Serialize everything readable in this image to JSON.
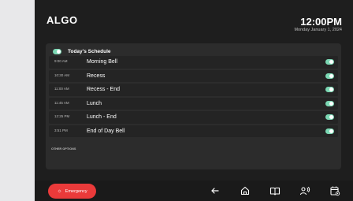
{
  "brand": "ALGO",
  "clock": {
    "time": "12:00PM",
    "date": "Monday January 1, 2024"
  },
  "schedule": {
    "title": "Today's Schedule",
    "enabled": true,
    "rows": [
      {
        "time": "9:00 AM",
        "name": "Morning Bell",
        "enabled": true
      },
      {
        "time": "10:30 AM",
        "name": "Recess",
        "enabled": true
      },
      {
        "time": "11:00 AM",
        "name": "Recess - End",
        "enabled": true
      },
      {
        "time": "11:45 AM",
        "name": "Lunch",
        "enabled": true
      },
      {
        "time": "12:25 PM",
        "name": "Lunch - End",
        "enabled": true
      },
      {
        "time": "3:51 PM",
        "name": "End of Day Bell",
        "enabled": true
      }
    ],
    "other_options": "OTHER OPTIONS"
  },
  "bottom_bar": {
    "emergency_label": "Emergency",
    "icons": [
      "back-arrow-icon",
      "home-icon",
      "book-icon",
      "speaker-person-icon",
      "calendar-settings-icon"
    ]
  },
  "colors": {
    "accent_green": "#7cd8b4",
    "emergency_red": "#ea3a3a"
  }
}
